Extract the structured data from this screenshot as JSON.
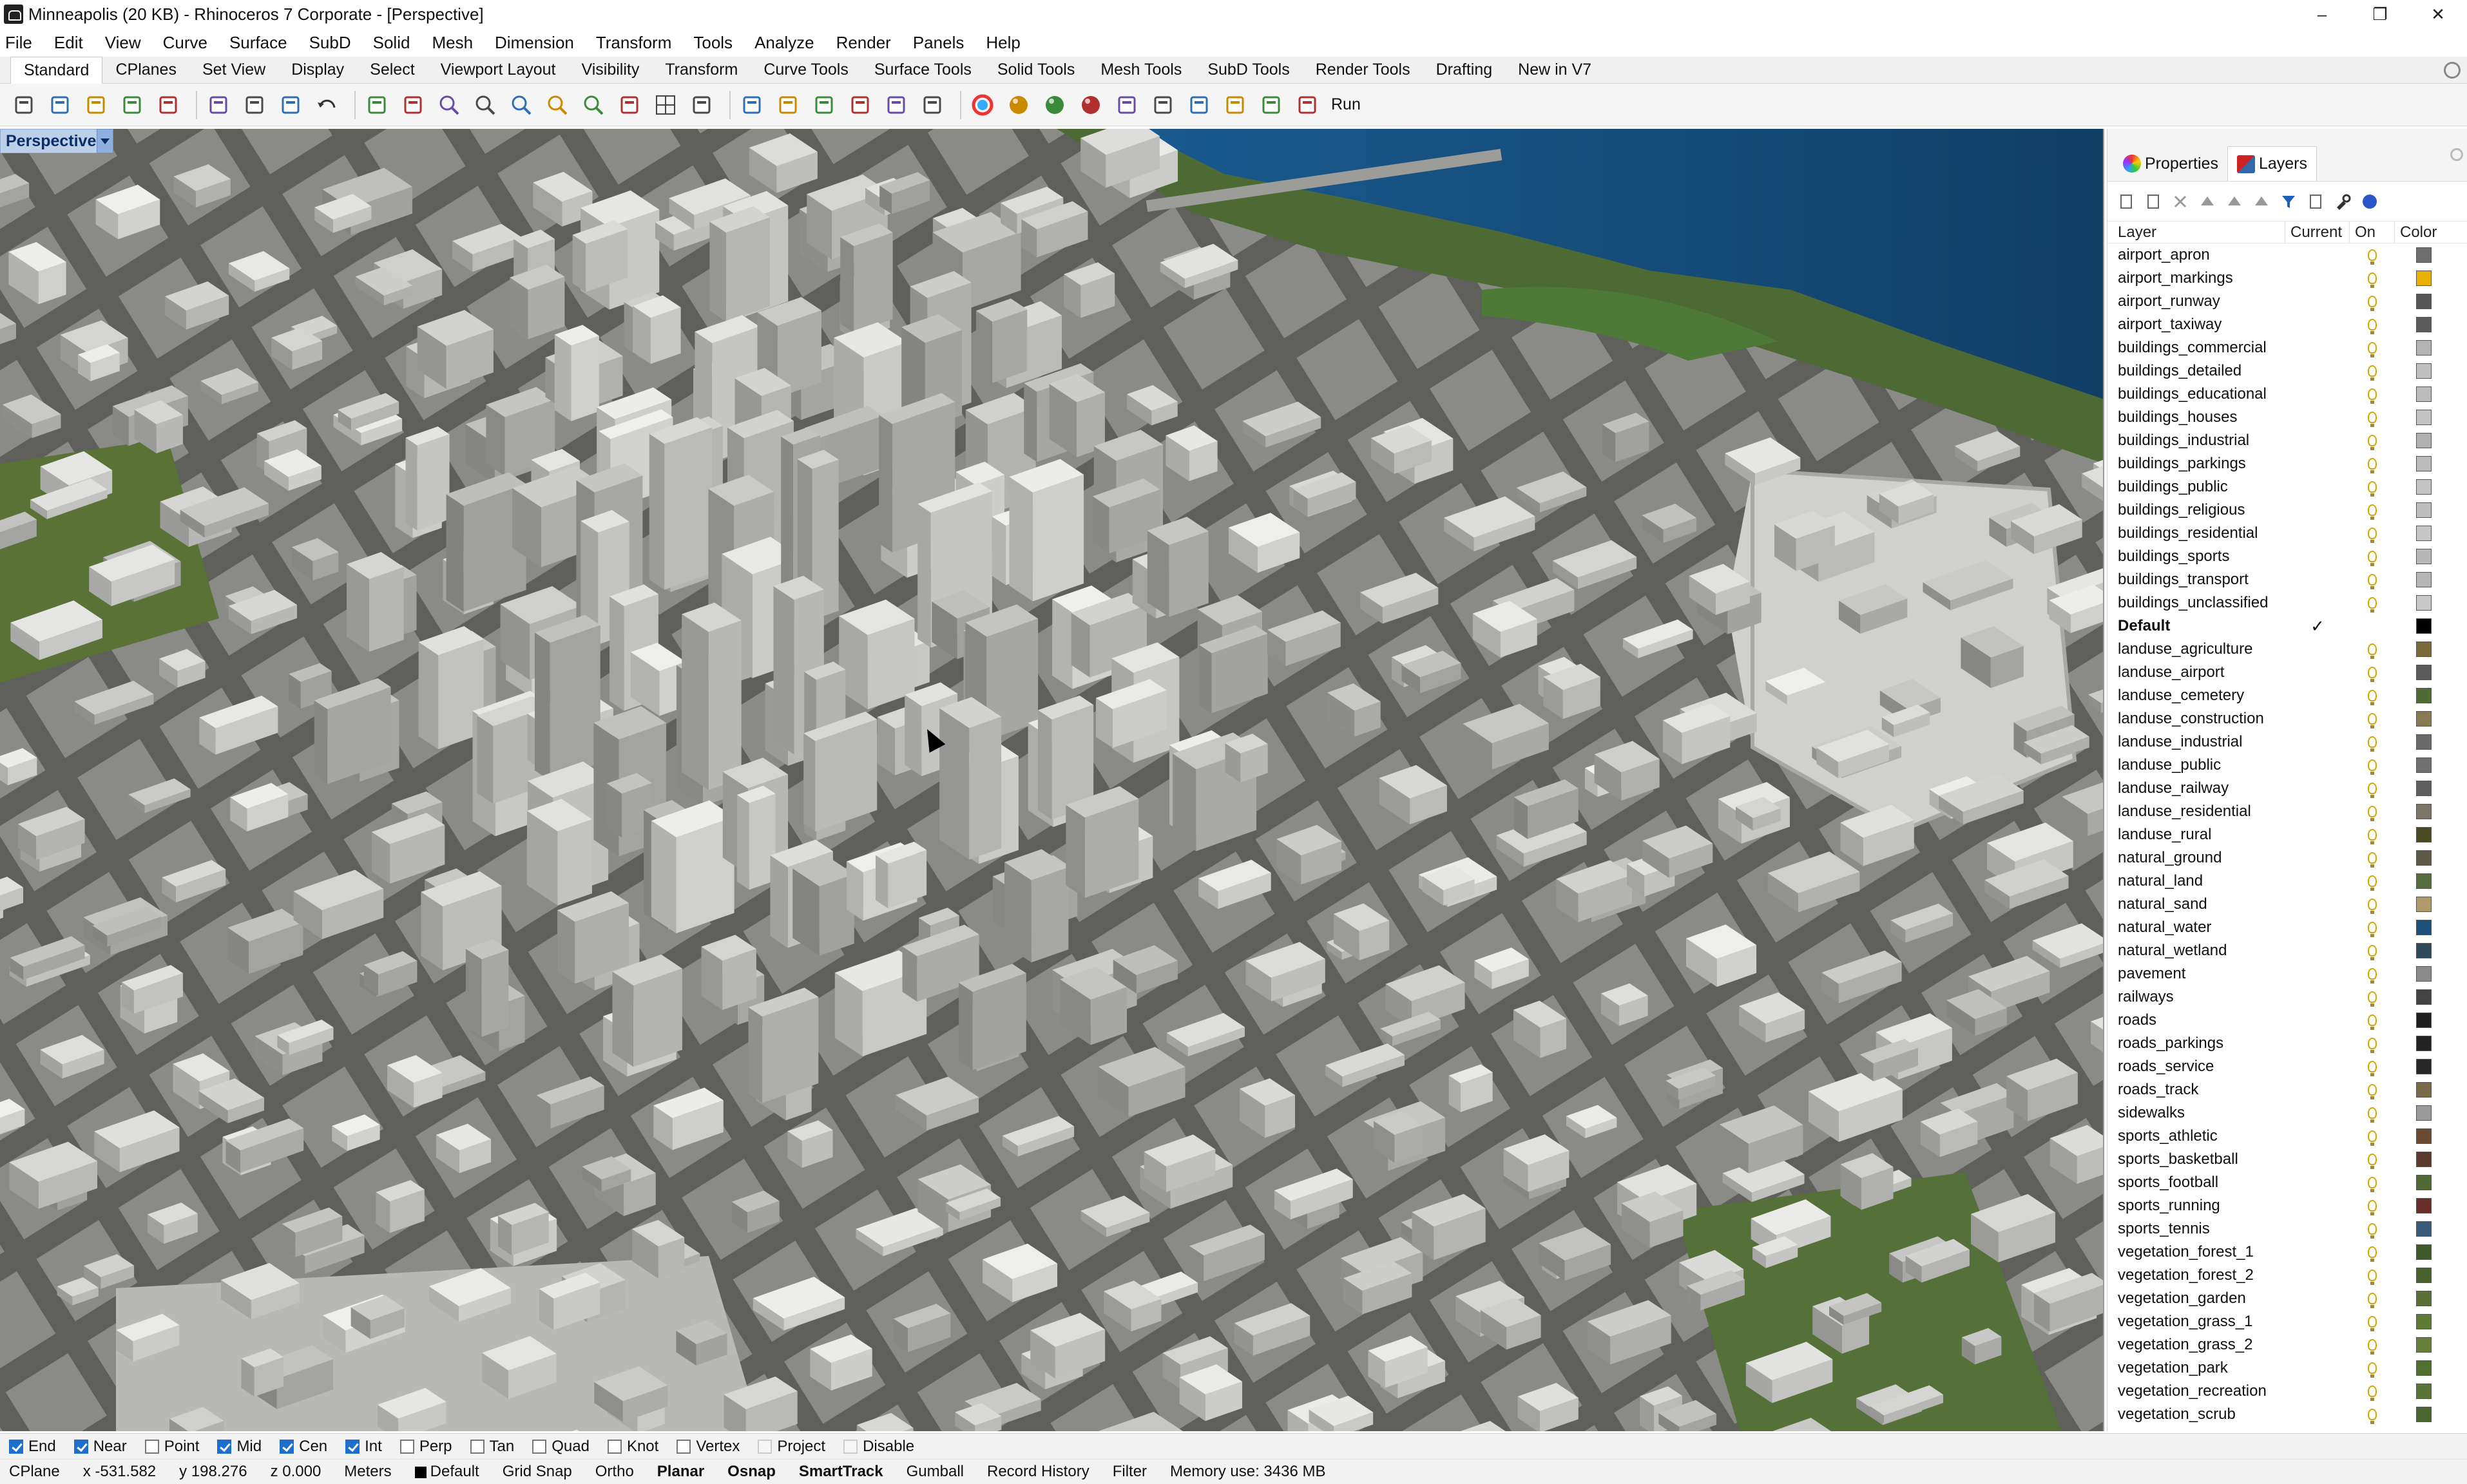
{
  "window": {
    "title": "Minneapolis (20 KB) - Rhinoceros 7 Corporate - [Perspective]",
    "minimize": "–",
    "maximize": "❐",
    "close": "✕"
  },
  "menu": [
    "File",
    "Edit",
    "View",
    "Curve",
    "Surface",
    "SubD",
    "Solid",
    "Mesh",
    "Dimension",
    "Transform",
    "Tools",
    "Analyze",
    "Render",
    "Panels",
    "Help"
  ],
  "tabs": [
    "Standard",
    "CPlanes",
    "Set View",
    "Display",
    "Select",
    "Viewport Layout",
    "Visibility",
    "Transform",
    "Curve Tools",
    "Surface Tools",
    "Solid Tools",
    "Mesh Tools",
    "SubD Tools",
    "Render Tools",
    "Drafting",
    "New in V7"
  ],
  "toolbar": {
    "icons": [
      "new-file",
      "open-file",
      "save",
      "print",
      "import",
      "cut",
      "copy",
      "paste",
      "undo",
      "pan",
      "rotate-view",
      "zoom",
      "zoom-window",
      "zoom-extents",
      "zoom-selected",
      "zoom-dynamic",
      "rotate-3d",
      "grid",
      "car",
      "hide",
      "shading",
      "snap-grid",
      "dimension",
      "lock",
      "layer",
      "color-wheel",
      "rendered-sphere",
      "ghosted-sphere",
      "xray-sphere",
      "materials",
      "light",
      "gear",
      "record",
      "properties",
      "run"
    ],
    "run_label": "Run"
  },
  "viewport": {
    "label": "Perspective"
  },
  "panel": {
    "tabs": [
      "Properties",
      "Layers"
    ],
    "columns": {
      "layer": "Layer",
      "current": "Current",
      "on": "On",
      "color": "Color"
    },
    "layers": [
      {
        "name": "airport_apron",
        "current": false,
        "color": "#6e6e6e"
      },
      {
        "name": "airport_markings",
        "current": false,
        "color": "#e8b000"
      },
      {
        "name": "airport_runway",
        "current": false,
        "color": "#555555"
      },
      {
        "name": "airport_taxiway",
        "current": false,
        "color": "#5a5a5a"
      },
      {
        "name": "buildings_commercial",
        "current": false,
        "color": "#b4b4b4"
      },
      {
        "name": "buildings_detailed",
        "current": false,
        "color": "#c0c0c0"
      },
      {
        "name": "buildings_educational",
        "current": false,
        "color": "#bcbcbc"
      },
      {
        "name": "buildings_houses",
        "current": false,
        "color": "#c2c2c2"
      },
      {
        "name": "buildings_industrial",
        "current": false,
        "color": "#b0b0b0"
      },
      {
        "name": "buildings_parkings",
        "current": false,
        "color": "#bababa"
      },
      {
        "name": "buildings_public",
        "current": false,
        "color": "#c4c4c4"
      },
      {
        "name": "buildings_religious",
        "current": false,
        "color": "#bebebe"
      },
      {
        "name": "buildings_residential",
        "current": false,
        "color": "#c6c6c6"
      },
      {
        "name": "buildings_sports",
        "current": false,
        "color": "#b8b8b8"
      },
      {
        "name": "buildings_transport",
        "current": false,
        "color": "#b6b6b6"
      },
      {
        "name": "buildings_unclassified",
        "current": false,
        "color": "#c8c8c8"
      },
      {
        "name": "Default",
        "current": true,
        "color": "#000000"
      },
      {
        "name": "landuse_agriculture",
        "current": false,
        "color": "#7a6a3a"
      },
      {
        "name": "landuse_airport",
        "current": false,
        "color": "#5a5a5a"
      },
      {
        "name": "landuse_cemetery",
        "current": false,
        "color": "#4f6b36"
      },
      {
        "name": "landuse_construction",
        "current": false,
        "color": "#8a7a52"
      },
      {
        "name": "landuse_industrial",
        "current": false,
        "color": "#6a6a6a"
      },
      {
        "name": "landuse_public",
        "current": false,
        "color": "#707070"
      },
      {
        "name": "landuse_railway",
        "current": false,
        "color": "#5e5e5e"
      },
      {
        "name": "landuse_residential",
        "current": false,
        "color": "#7c7466"
      },
      {
        "name": "landuse_rural",
        "current": false,
        "color": "#4a4a22"
      },
      {
        "name": "natural_ground",
        "current": false,
        "color": "#5c5a46"
      },
      {
        "name": "natural_land",
        "current": false,
        "color": "#566b3e"
      },
      {
        "name": "natural_sand",
        "current": false,
        "color": "#b09a6a"
      },
      {
        "name": "natural_water",
        "current": false,
        "color": "#1d4f7a"
      },
      {
        "name": "natural_wetland",
        "current": false,
        "color": "#2e4a5a"
      },
      {
        "name": "pavement",
        "current": false,
        "color": "#8a8a8a"
      },
      {
        "name": "railways",
        "current": false,
        "color": "#444444"
      },
      {
        "name": "roads",
        "current": false,
        "color": "#1e1e1e"
      },
      {
        "name": "roads_parkings",
        "current": false,
        "color": "#222222"
      },
      {
        "name": "roads_service",
        "current": false,
        "color": "#262626"
      },
      {
        "name": "roads_track",
        "current": false,
        "color": "#7a6a4a"
      },
      {
        "name": "sidewalks",
        "current": false,
        "color": "#9a9a9a"
      },
      {
        "name": "sports_athletic",
        "current": false,
        "color": "#6a4a32"
      },
      {
        "name": "sports_basketball",
        "current": false,
        "color": "#5a3a2a"
      },
      {
        "name": "sports_football",
        "current": false,
        "color": "#4e6a32"
      },
      {
        "name": "sports_running",
        "current": false,
        "color": "#6a2e2a"
      },
      {
        "name": "sports_tennis",
        "current": false,
        "color": "#3a5a7a"
      },
      {
        "name": "vegetation_forest_1",
        "current": false,
        "color": "#3e5a2a"
      },
      {
        "name": "vegetation_forest_2",
        "current": false,
        "color": "#48622e"
      },
      {
        "name": "vegetation_garden",
        "current": false,
        "color": "#5a6e36"
      },
      {
        "name": "vegetation_grass_1",
        "current": false,
        "color": "#5e7a34"
      },
      {
        "name": "vegetation_grass_2",
        "current": false,
        "color": "#667e3a"
      },
      {
        "name": "vegetation_park",
        "current": false,
        "color": "#50702e"
      },
      {
        "name": "vegetation_recreation",
        "current": false,
        "color": "#587436"
      },
      {
        "name": "vegetation_scrub",
        "current": false,
        "color": "#4a6630"
      }
    ]
  },
  "osnaps": [
    {
      "label": "End",
      "on": true
    },
    {
      "label": "Near",
      "on": true
    },
    {
      "label": "Point",
      "on": false
    },
    {
      "label": "Mid",
      "on": true
    },
    {
      "label": "Cen",
      "on": true
    },
    {
      "label": "Int",
      "on": true
    },
    {
      "label": "Perp",
      "on": false
    },
    {
      "label": "Tan",
      "on": false
    },
    {
      "label": "Quad",
      "on": false
    },
    {
      "label": "Knot",
      "on": false
    },
    {
      "label": "Vertex",
      "on": false
    },
    {
      "label": "Project",
      "on": false
    },
    {
      "label": "Disable",
      "on": false
    }
  ],
  "status": {
    "cplane": "CPlane",
    "x": "x -531.582",
    "y": "y 198.276",
    "z": "z 0.000",
    "units": "Meters",
    "layer": "Default",
    "grid_snap": "Grid Snap",
    "ortho": "Ortho",
    "planar": "Planar",
    "osnap": "Osnap",
    "smarttrack": "SmartTrack",
    "gumball": "Gumball",
    "record_history": "Record History",
    "filter": "Filter",
    "memory": "Memory use: 3436 MB"
  }
}
